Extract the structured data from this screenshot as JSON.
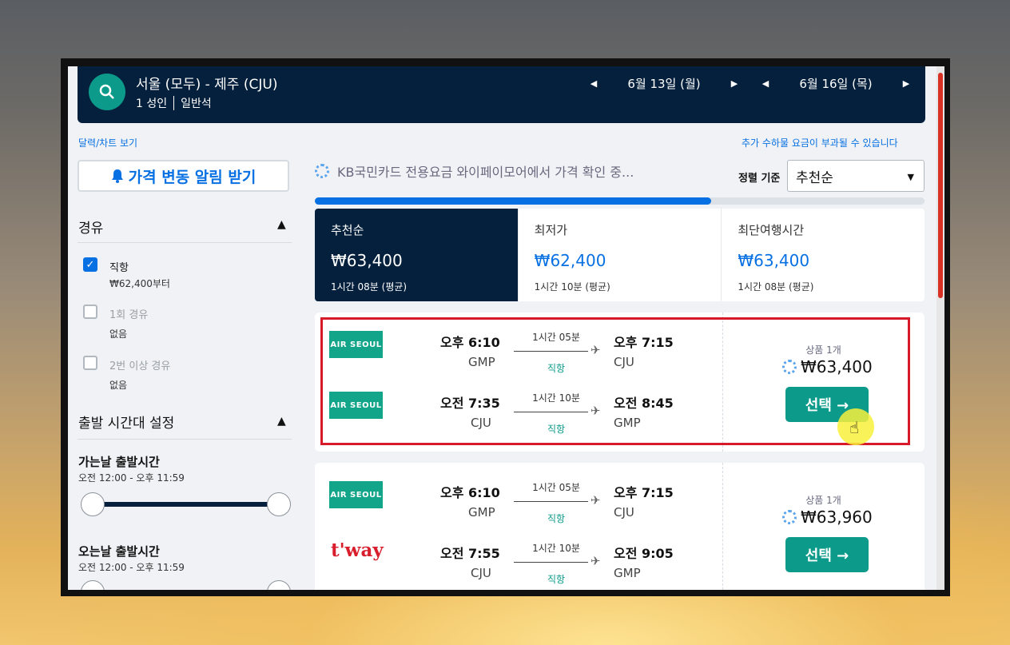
{
  "header": {
    "route": "서울 (모두) - 제주 (CJU)",
    "passengers": "1 성인",
    "cabin": "일반석",
    "depart_date": "6월 13일 (월)",
    "return_date": "6월 16일 (목)"
  },
  "links": {
    "calendar": "달력/차트 보기",
    "extra_fee": "추가 수하물 요금이 부과될 수 있습니다"
  },
  "price_alert_label": "가격 변동 알림 받기",
  "filters": {
    "stops_title": "경유",
    "stops": [
      {
        "label": "직항",
        "sub": "₩62,400부터",
        "checked": true
      },
      {
        "label": "1회 경유",
        "sub": "없음",
        "checked": false
      },
      {
        "label": "2번 이상 경유",
        "sub": "없음",
        "checked": false
      }
    ],
    "time_title": "출발 시간대 설정",
    "outbound": {
      "title": "가는날 출발시간",
      "range": "오전 12:00 - 오후 11:59"
    },
    "inbound": {
      "title": "오는날 출발시간",
      "range": "오전 12:00 - 오후 11:59"
    }
  },
  "loading_text": "KB국민카드 전용요금 와이페이모어에서 가격 확인 중...",
  "sort": {
    "label": "정렬 기준",
    "value": "추천순"
  },
  "progress": 0.65,
  "tabs": [
    {
      "name": "추천순",
      "price": "₩63,400",
      "time": "1시간 08분 (평균)"
    },
    {
      "name": "최저가",
      "price": "₩62,400",
      "time": "1시간 10분 (평균)"
    },
    {
      "name": "최단여행시간",
      "price": "₩63,400",
      "time": "1시간 08분 (평균)"
    }
  ],
  "results": [
    {
      "legs": [
        {
          "airline": "AIR SEOUL",
          "dep": "오후 6:10",
          "from": "GMP",
          "dur": "1시간 05분",
          "type": "직항",
          "arr": "오후 7:15",
          "to": "CJU"
        },
        {
          "airline": "AIR SEOUL",
          "dep": "오전 7:35",
          "from": "CJU",
          "dur": "1시간 10분",
          "type": "직항",
          "arr": "오전 8:45",
          "to": "GMP"
        }
      ],
      "offers": "상품 1개",
      "price": "₩63,400",
      "select": "선택 →"
    },
    {
      "legs": [
        {
          "airline": "AIR SEOUL",
          "dep": "오후 6:10",
          "from": "GMP",
          "dur": "1시간 05분",
          "type": "직항",
          "arr": "오후 7:15",
          "to": "CJU"
        },
        {
          "airline": "t'way",
          "dep": "오전 7:55",
          "from": "CJU",
          "dur": "1시간 10분",
          "type": "직항",
          "arr": "오전 9:05",
          "to": "GMP"
        }
      ],
      "offers": "상품 1개",
      "price": "₩63,960",
      "select": "선택 →"
    }
  ],
  "colors": {
    "navy": "#05203c",
    "teal": "#0c9b8a",
    "blue": "#0770e3",
    "highlight": "#d61a2a"
  }
}
